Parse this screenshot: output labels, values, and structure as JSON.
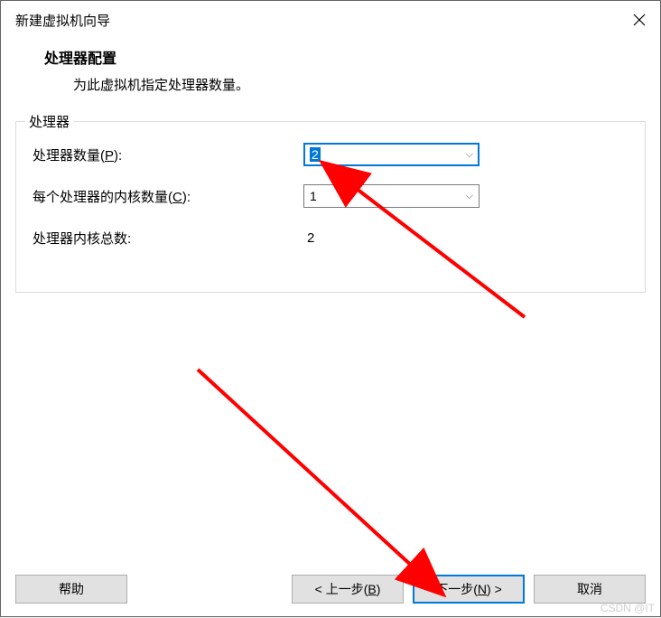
{
  "dialog": {
    "title": "新建虚拟机向导"
  },
  "header": {
    "title": "处理器配置",
    "description": "为此虚拟机指定处理器数量。"
  },
  "group": {
    "legend": "处理器",
    "fields": {
      "processor_count": {
        "label_pre": "处理器数量(",
        "accel": "P",
        "label_post": "):",
        "value": "2"
      },
      "cores_per_processor": {
        "label_pre": "每个处理器的内核数量(",
        "accel": "C",
        "label_post": "):",
        "value": "1"
      },
      "total_cores": {
        "label": "处理器内核总数:",
        "value": "2"
      }
    }
  },
  "buttons": {
    "help": "帮助",
    "back_pre": "< 上一步(",
    "back_accel": "B",
    "back_post": ")",
    "next_pre": "下一步(",
    "next_accel": "N",
    "next_post": ") >",
    "cancel": "取消"
  },
  "watermark": "CSDN @IT"
}
